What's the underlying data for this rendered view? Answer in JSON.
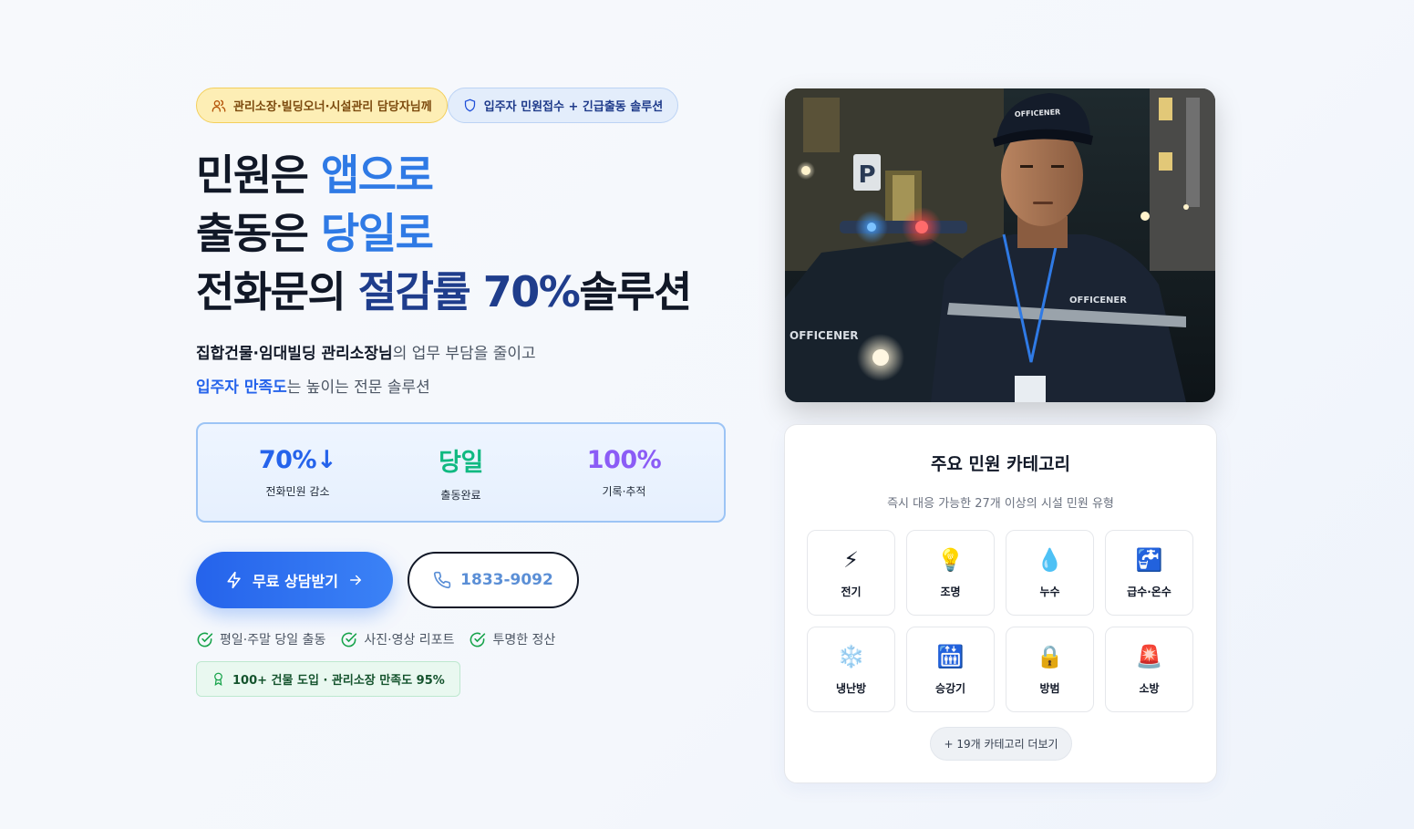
{
  "badges": {
    "target": "관리소장·빌딩오너·시설관리 담당자님께",
    "solution": "입주자 민원접수 + 긴급출동 솔루션"
  },
  "headline": {
    "line1_a": "민원은 ",
    "line1_b": "앱으로",
    "line2_a": "출동은 ",
    "line2_b": "당일로",
    "line3_a": "전화문의 ",
    "line3_b": "절감률 70%",
    "line3_c": "솔루션"
  },
  "subtitle": {
    "line1_bold": "집합건물·임대빌딩 관리소장님",
    "line1_rest": "의 업무 부담을 줄이고",
    "line2_blue": "입주자 만족도",
    "line2_rest": "는 높이는 전문 솔루션"
  },
  "stats": [
    {
      "value": "70%↓",
      "label": "전화민원 감소",
      "color": "#2563eb"
    },
    {
      "value": "당일",
      "label": "출동완료",
      "color": "#10b981"
    },
    {
      "value": "100%",
      "label": "기록·추적",
      "color": "#8b5cf6"
    }
  ],
  "cta": {
    "primary": "무료 상담받기",
    "phone": "1833-9092"
  },
  "checks": [
    "평일·주말 당일 출동",
    "사진·영상 리포트",
    "투명한 정산"
  ],
  "trust": "100+ 건물 도입 · 관리소장 만족도 95%",
  "photo": {
    "cap_text": "OFFICENER",
    "jacket_text": "OFFICENER",
    "car_text": "OFFICENER",
    "parking_sign": "P"
  },
  "category_card": {
    "title": "주요 민원 카테고리",
    "description": "즉시 대응 가능한 27개 이상의 시설 민원 유형",
    "items": [
      {
        "icon": "⚡",
        "label": "전기"
      },
      {
        "icon": "💡",
        "label": "조명"
      },
      {
        "icon": "💧",
        "label": "누수"
      },
      {
        "icon": "🚰",
        "label": "급수·온수"
      },
      {
        "icon": "❄️",
        "label": "냉난방"
      },
      {
        "icon": "🛗",
        "label": "승강기"
      },
      {
        "icon": "🔒",
        "label": "방범"
      },
      {
        "icon": "🚨",
        "label": "소방"
      }
    ],
    "more": "+ 19개 카테고리 더보기"
  }
}
